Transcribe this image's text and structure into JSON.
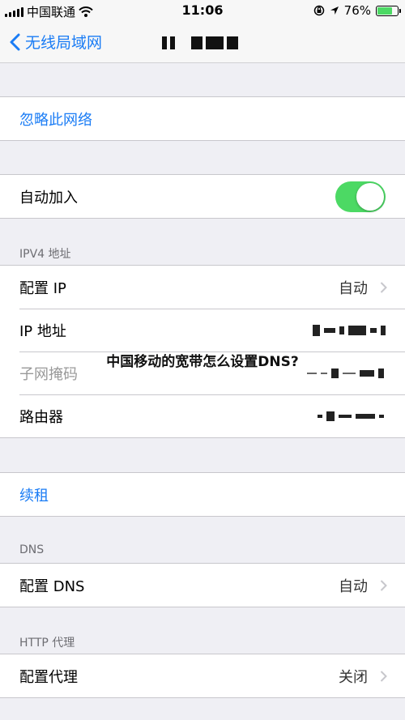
{
  "status_bar": {
    "carrier": "中国联通",
    "time": "11:06",
    "battery_percent": "76%",
    "battery_level": 0.76
  },
  "nav": {
    "back_label": "无线局域网"
  },
  "rows": {
    "forget_network": "忽略此网络",
    "auto_join": "自动加入",
    "auto_join_on": true,
    "ipv4_header": "IPV4 地址",
    "configure_ip": "配置 IP",
    "configure_ip_value": "自动",
    "ip_address": "IP 地址",
    "subnet_mask": "子网掩码",
    "router": "路由器",
    "renew_lease": "续租",
    "dns_header": "DNS",
    "configure_dns": "配置 DNS",
    "configure_dns_value": "自动",
    "http_proxy_header": "HTTP 代理",
    "configure_proxy": "配置代理",
    "configure_proxy_value": "关闭"
  },
  "overlay_caption": "中国移动的宽带怎么设置DNS?",
  "colors": {
    "accent": "#1a7cf5",
    "toggle_on": "#4cd964",
    "background": "#efeff4"
  }
}
